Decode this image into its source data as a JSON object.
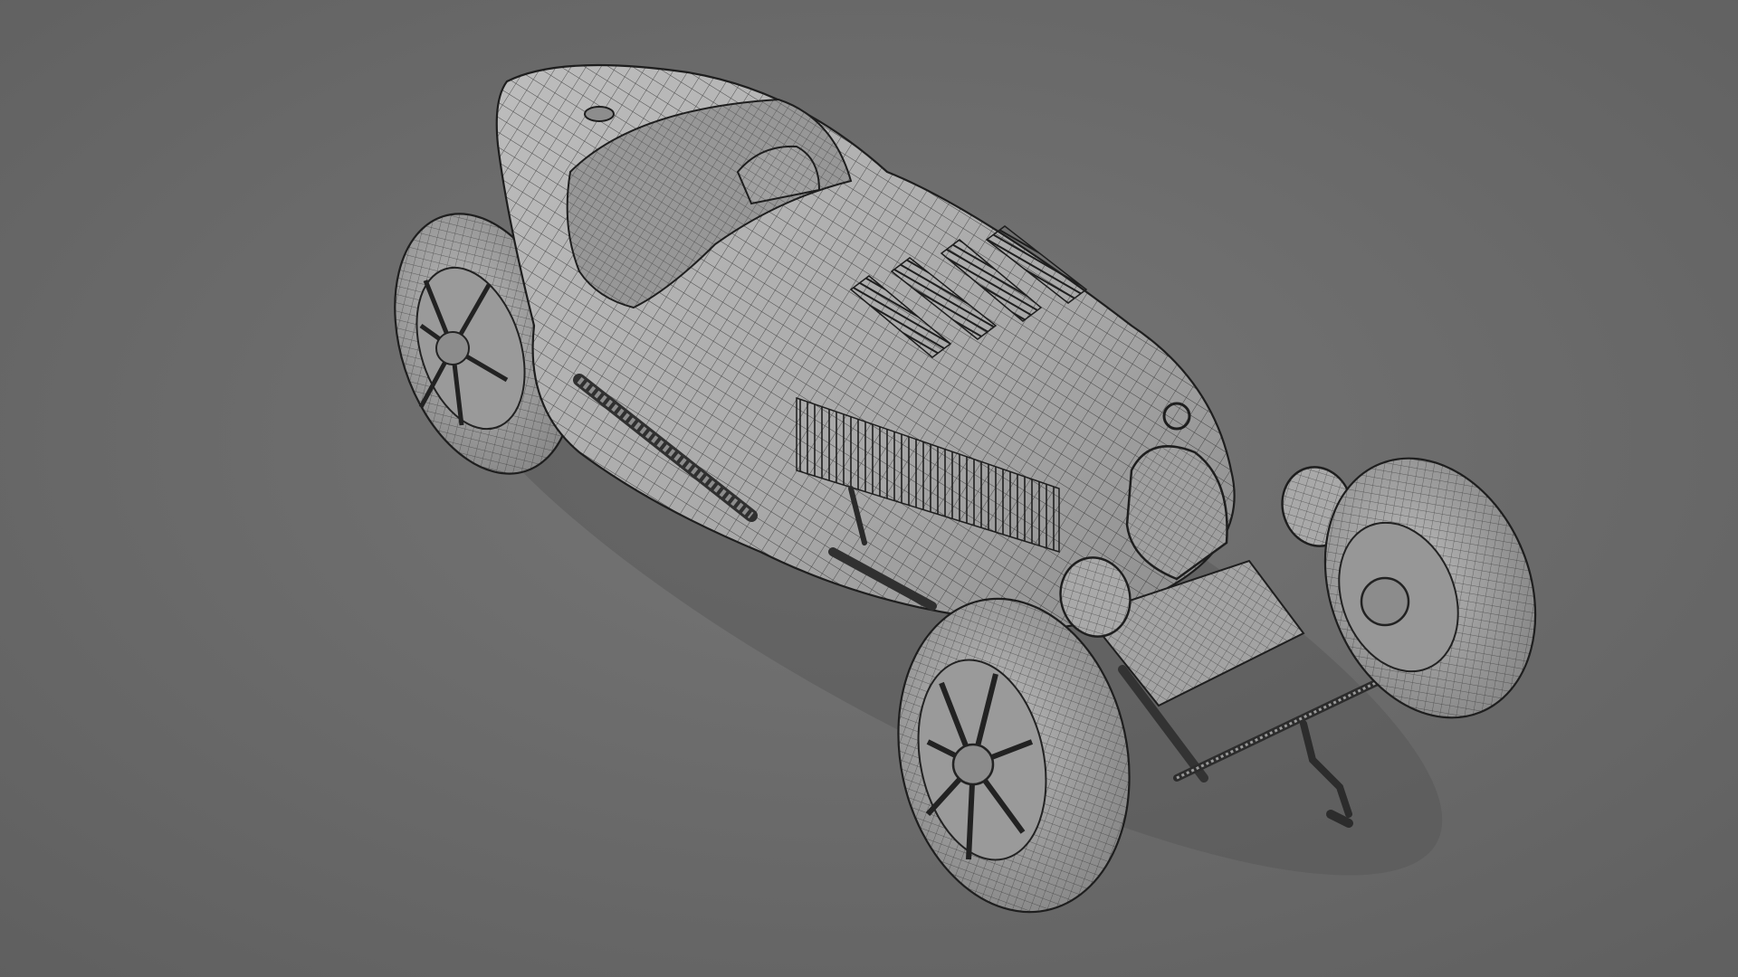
{
  "scene": {
    "subject": "vintage-race-car-wireframe-render",
    "background_color": "#6d6d6d",
    "body_color": "#a9a9a9",
    "wire_color": "#2a2a2a"
  }
}
